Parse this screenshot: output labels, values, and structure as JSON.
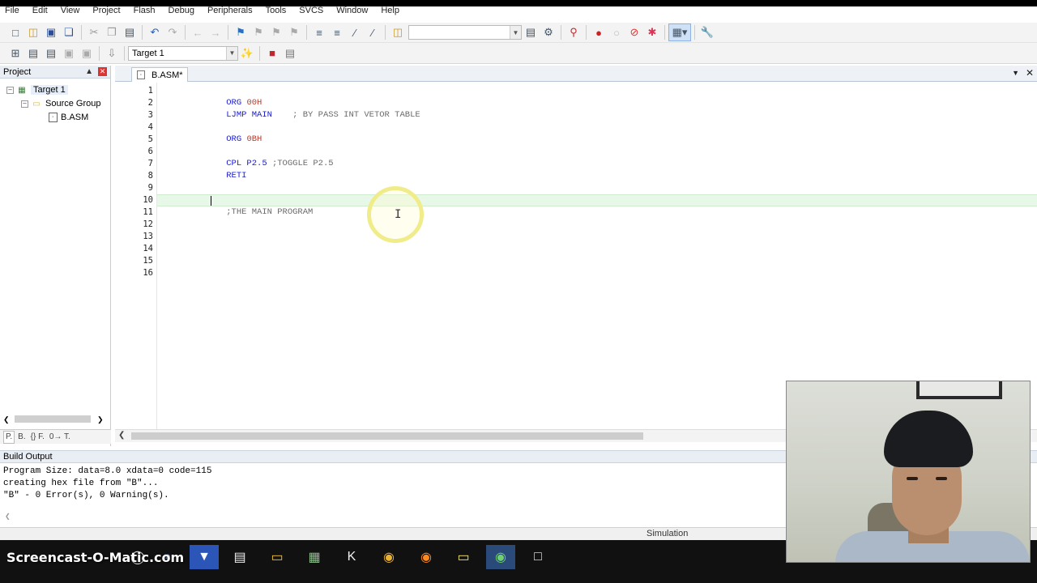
{
  "menu": [
    "File",
    "Edit",
    "View",
    "Project",
    "Flash",
    "Debug",
    "Peripherals",
    "Tools",
    "SVCS",
    "Window",
    "Help"
  ],
  "toolbar": {
    "target_select": "Target 1"
  },
  "project_pane": {
    "title": "Project",
    "tree": {
      "target": "Target 1",
      "group": "Source Group",
      "file": "B.ASM"
    },
    "bottom_tabs": [
      "P.",
      "B.",
      "{} F.",
      "0→ T."
    ]
  },
  "editor": {
    "tab_label": "B.ASM*",
    "line_numbers": [
      "1",
      "2",
      "3",
      "4",
      "5",
      "6",
      "7",
      "8",
      "9",
      "10",
      "11",
      "12",
      "13",
      "14",
      "15",
      "16"
    ],
    "lines": {
      "l1_kw": "ORG ",
      "l1_num": "00H",
      "l2_kw": "LJMP MAIN",
      "l2_cmt": "    ; BY PASS INT VETOR TABLE",
      "l4_kw": "ORG ",
      "l4_num": "0BH",
      "l6_kw": "CPL P2.5",
      "l6_cmt": " ;TOGGLE P2.5",
      "l7_kw": "RETI",
      "l10_cmt": ";THE MAIN PROGRAM"
    },
    "current_line": 10
  },
  "build_output": {
    "title": "Build Output",
    "lines": [
      "Program Size: data=8.0 xdata=0 code=115",
      "creating hex file from \"B\"...",
      "\"B\" - 0 Error(s), 0 Warning(s)."
    ]
  },
  "status": {
    "mode": "Simulation"
  },
  "watermark": "Screencast-O-Matic.com",
  "colors": {
    "keyword": "#1b1bd0",
    "number": "#c0392b",
    "comment": "#6b6b6b",
    "current_line_bg": "#e8f8e8",
    "taskbar": "#111111"
  }
}
